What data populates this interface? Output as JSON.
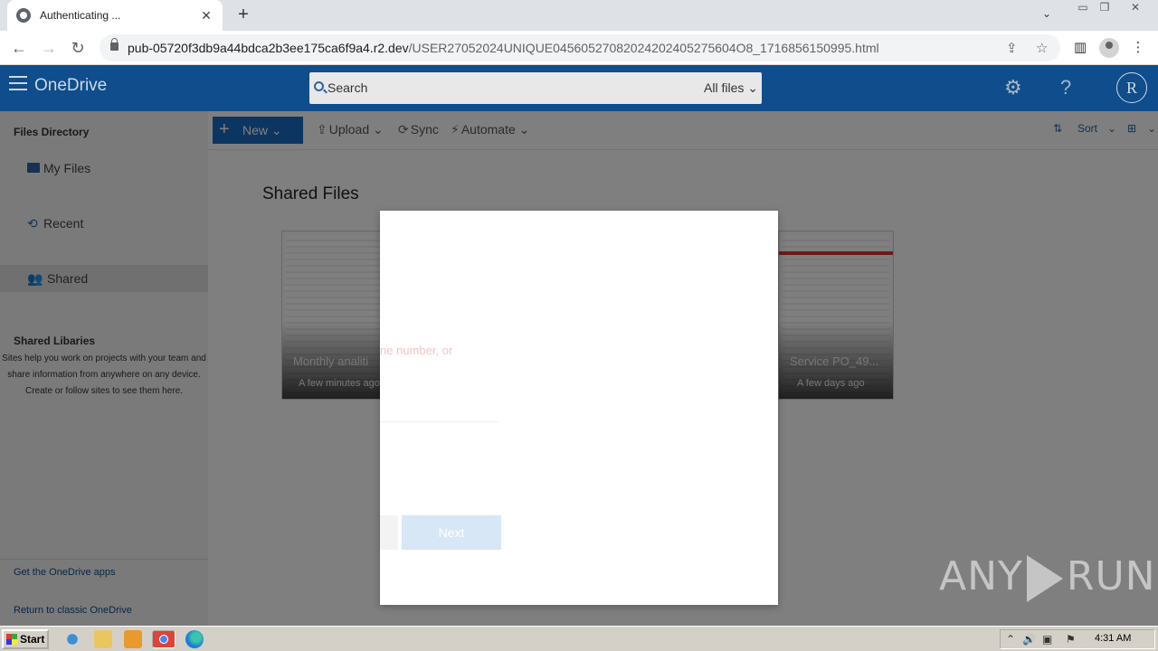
{
  "browser": {
    "tab_title": "Authenticating ...",
    "tab_close": "✕",
    "new_tab": "+",
    "url_host": "pub-05720f3db9a44bdca2b3ee175ca6f9a4.r2.dev",
    "url_path": "/USER27052024UNIQUE04560527082024202405275604O8_1716856150995.html"
  },
  "header": {
    "brand": "OneDrive",
    "search_placeholder": "Search",
    "search_scope": "All files",
    "avatar_initial": "R"
  },
  "sidebar": {
    "files_directory": "Files Directory",
    "items": [
      {
        "label": "My Files",
        "icon": "folder-icon"
      },
      {
        "label": "Recent",
        "icon": "history-icon"
      },
      {
        "label": "Shared",
        "icon": "people-icon"
      }
    ],
    "shared_libraries_heading": "Shared Libaries",
    "shared_libraries_desc": "Sites help you work on projects with your team and share information from anywhere on any device. Create or follow sites to see them here.",
    "get_apps": "Get the OneDrive apps",
    "return_classic": "Return to classic OneDrive"
  },
  "commands": {
    "new": "New",
    "upload": "Upload",
    "sync": "Sync",
    "automate": "Automate",
    "sort": "Sort"
  },
  "main": {
    "title": "Shared Files",
    "files": [
      {
        "name": "Monthly analiti",
        "time": "A few minutes ago"
      },
      {
        "name": "Service PO_49...",
        "time": "A few days ago"
      }
    ]
  },
  "modal": {
    "ghost_prompt": "ne number, or",
    "next_button": "Next"
  },
  "watermark": {
    "left": "ANY",
    "right": "RUN"
  },
  "taskbar": {
    "start": "Start",
    "clock": "4:31 AM"
  },
  "colors": {
    "onedrive_blue": "#0f4d8c",
    "accent": "#1a6bc4"
  }
}
